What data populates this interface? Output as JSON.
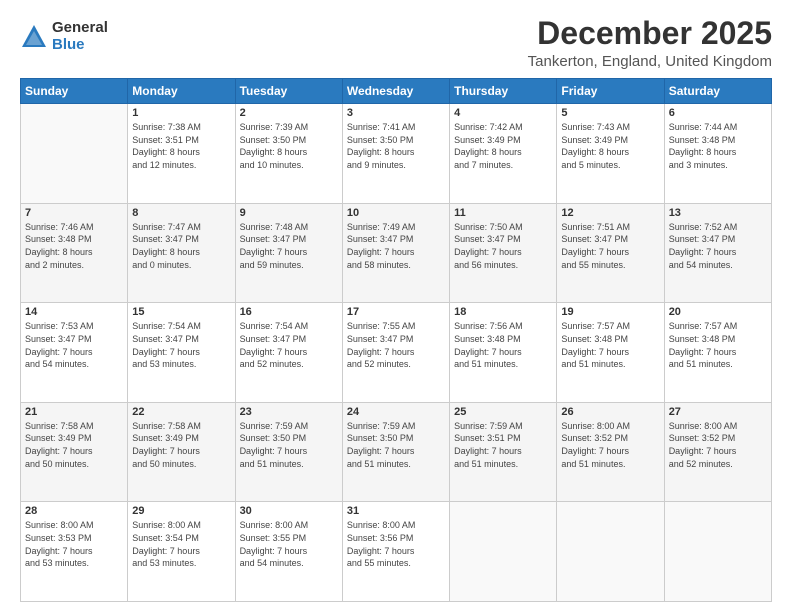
{
  "logo": {
    "general": "General",
    "blue": "Blue"
  },
  "title": "December 2025",
  "subtitle": "Tankerton, England, United Kingdom",
  "days_header": [
    "Sunday",
    "Monday",
    "Tuesday",
    "Wednesday",
    "Thursday",
    "Friday",
    "Saturday"
  ],
  "weeks": [
    [
      {
        "day": "",
        "content": ""
      },
      {
        "day": "1",
        "content": "Sunrise: 7:38 AM\nSunset: 3:51 PM\nDaylight: 8 hours\nand 12 minutes."
      },
      {
        "day": "2",
        "content": "Sunrise: 7:39 AM\nSunset: 3:50 PM\nDaylight: 8 hours\nand 10 minutes."
      },
      {
        "day": "3",
        "content": "Sunrise: 7:41 AM\nSunset: 3:50 PM\nDaylight: 8 hours\nand 9 minutes."
      },
      {
        "day": "4",
        "content": "Sunrise: 7:42 AM\nSunset: 3:49 PM\nDaylight: 8 hours\nand 7 minutes."
      },
      {
        "day": "5",
        "content": "Sunrise: 7:43 AM\nSunset: 3:49 PM\nDaylight: 8 hours\nand 5 minutes."
      },
      {
        "day": "6",
        "content": "Sunrise: 7:44 AM\nSunset: 3:48 PM\nDaylight: 8 hours\nand 3 minutes."
      }
    ],
    [
      {
        "day": "7",
        "content": "Sunrise: 7:46 AM\nSunset: 3:48 PM\nDaylight: 8 hours\nand 2 minutes."
      },
      {
        "day": "8",
        "content": "Sunrise: 7:47 AM\nSunset: 3:47 PM\nDaylight: 8 hours\nand 0 minutes."
      },
      {
        "day": "9",
        "content": "Sunrise: 7:48 AM\nSunset: 3:47 PM\nDaylight: 7 hours\nand 59 minutes."
      },
      {
        "day": "10",
        "content": "Sunrise: 7:49 AM\nSunset: 3:47 PM\nDaylight: 7 hours\nand 58 minutes."
      },
      {
        "day": "11",
        "content": "Sunrise: 7:50 AM\nSunset: 3:47 PM\nDaylight: 7 hours\nand 56 minutes."
      },
      {
        "day": "12",
        "content": "Sunrise: 7:51 AM\nSunset: 3:47 PM\nDaylight: 7 hours\nand 55 minutes."
      },
      {
        "day": "13",
        "content": "Sunrise: 7:52 AM\nSunset: 3:47 PM\nDaylight: 7 hours\nand 54 minutes."
      }
    ],
    [
      {
        "day": "14",
        "content": "Sunrise: 7:53 AM\nSunset: 3:47 PM\nDaylight: 7 hours\nand 54 minutes."
      },
      {
        "day": "15",
        "content": "Sunrise: 7:54 AM\nSunset: 3:47 PM\nDaylight: 7 hours\nand 53 minutes."
      },
      {
        "day": "16",
        "content": "Sunrise: 7:54 AM\nSunset: 3:47 PM\nDaylight: 7 hours\nand 52 minutes."
      },
      {
        "day": "17",
        "content": "Sunrise: 7:55 AM\nSunset: 3:47 PM\nDaylight: 7 hours\nand 52 minutes."
      },
      {
        "day": "18",
        "content": "Sunrise: 7:56 AM\nSunset: 3:48 PM\nDaylight: 7 hours\nand 51 minutes."
      },
      {
        "day": "19",
        "content": "Sunrise: 7:57 AM\nSunset: 3:48 PM\nDaylight: 7 hours\nand 51 minutes."
      },
      {
        "day": "20",
        "content": "Sunrise: 7:57 AM\nSunset: 3:48 PM\nDaylight: 7 hours\nand 51 minutes."
      }
    ],
    [
      {
        "day": "21",
        "content": "Sunrise: 7:58 AM\nSunset: 3:49 PM\nDaylight: 7 hours\nand 50 minutes."
      },
      {
        "day": "22",
        "content": "Sunrise: 7:58 AM\nSunset: 3:49 PM\nDaylight: 7 hours\nand 50 minutes."
      },
      {
        "day": "23",
        "content": "Sunrise: 7:59 AM\nSunset: 3:50 PM\nDaylight: 7 hours\nand 51 minutes."
      },
      {
        "day": "24",
        "content": "Sunrise: 7:59 AM\nSunset: 3:50 PM\nDaylight: 7 hours\nand 51 minutes."
      },
      {
        "day": "25",
        "content": "Sunrise: 7:59 AM\nSunset: 3:51 PM\nDaylight: 7 hours\nand 51 minutes."
      },
      {
        "day": "26",
        "content": "Sunrise: 8:00 AM\nSunset: 3:52 PM\nDaylight: 7 hours\nand 51 minutes."
      },
      {
        "day": "27",
        "content": "Sunrise: 8:00 AM\nSunset: 3:52 PM\nDaylight: 7 hours\nand 52 minutes."
      }
    ],
    [
      {
        "day": "28",
        "content": "Sunrise: 8:00 AM\nSunset: 3:53 PM\nDaylight: 7 hours\nand 53 minutes."
      },
      {
        "day": "29",
        "content": "Sunrise: 8:00 AM\nSunset: 3:54 PM\nDaylight: 7 hours\nand 53 minutes."
      },
      {
        "day": "30",
        "content": "Sunrise: 8:00 AM\nSunset: 3:55 PM\nDaylight: 7 hours\nand 54 minutes."
      },
      {
        "day": "31",
        "content": "Sunrise: 8:00 AM\nSunset: 3:56 PM\nDaylight: 7 hours\nand 55 minutes."
      },
      {
        "day": "",
        "content": ""
      },
      {
        "day": "",
        "content": ""
      },
      {
        "day": "",
        "content": ""
      }
    ]
  ]
}
